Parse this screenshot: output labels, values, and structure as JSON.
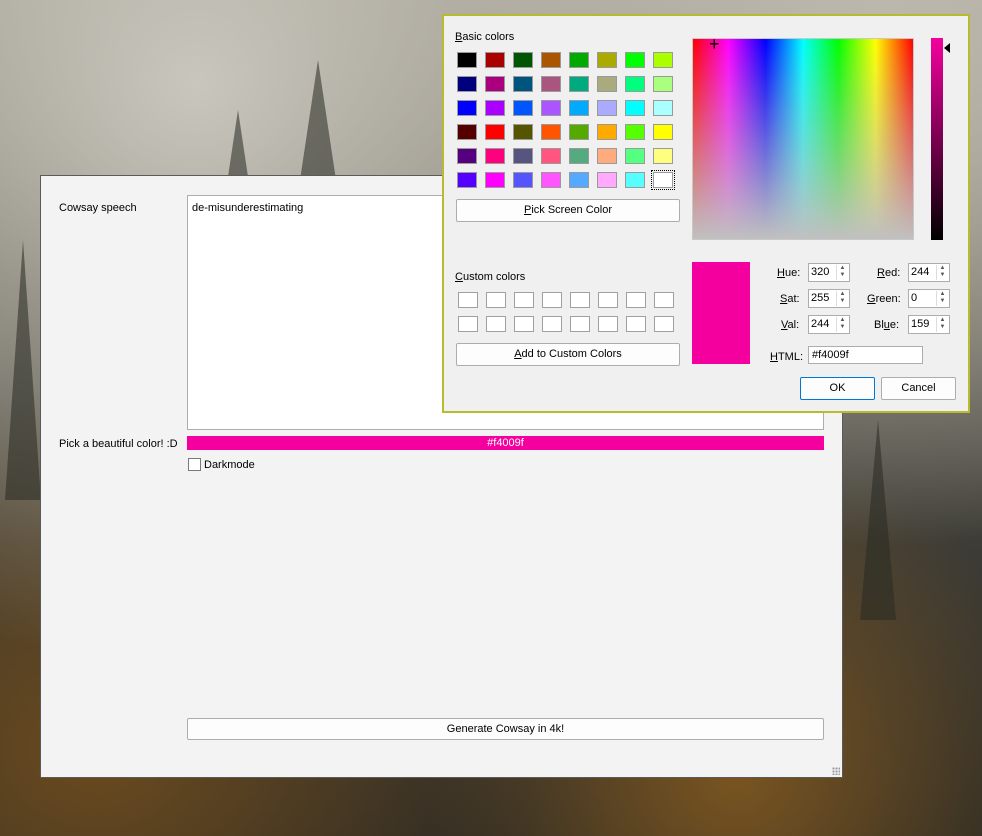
{
  "main_window": {
    "speech_label": "Cowsay speech",
    "speech_text": "de-misunderestimating",
    "color_label": "Pick a beautiful color! :D",
    "color_value": "#f4009f",
    "darkmode_label": "Darkmode",
    "darkmode_checked": false,
    "generate_button": "Generate Cowsay in 4k!"
  },
  "color_dialog": {
    "basic_colors_label": "Basic colors",
    "basic_colors": [
      "#000000",
      "#aa0000",
      "#005500",
      "#aa5500",
      "#00aa00",
      "#aaaa00",
      "#00ff00",
      "#aaff00",
      "#00007f",
      "#aa007f",
      "#00557f",
      "#aa557f",
      "#00aa7f",
      "#aaaa7f",
      "#00ff7f",
      "#aaff7f",
      "#0000ff",
      "#aa00ff",
      "#0055ff",
      "#aa55ff",
      "#00aaff",
      "#aaaaff",
      "#00ffff",
      "#aaffff",
      "#550000",
      "#ff0000",
      "#555500",
      "#ff5500",
      "#55aa00",
      "#ffaa00",
      "#55ff00",
      "#ffff00",
      "#55007f",
      "#ff007f",
      "#55557f",
      "#ff557f",
      "#55aa7f",
      "#ffaa7f",
      "#55ff7f",
      "#ffff7f",
      "#5500ff",
      "#ff00ff",
      "#5555ff",
      "#ff55ff",
      "#55aaff",
      "#ffaaff",
      "#55ffff",
      "#ffffff"
    ],
    "pick_screen_color": "Pick Screen Color",
    "custom_colors_label": "Custom colors",
    "add_custom": "Add to Custom Colors",
    "hue_label": "Hue:",
    "hue": "320",
    "sat_label": "Sat:",
    "sat": "255",
    "val_label": "Val:",
    "val": "244",
    "red_label": "Red:",
    "red": "244",
    "green_label": "Green:",
    "green": "0",
    "blue_label": "Blue:",
    "blue": "159",
    "html_label": "HTML:",
    "html": "#f4009f",
    "ok": "OK",
    "cancel": "Cancel",
    "current_color": "#f4009f"
  }
}
